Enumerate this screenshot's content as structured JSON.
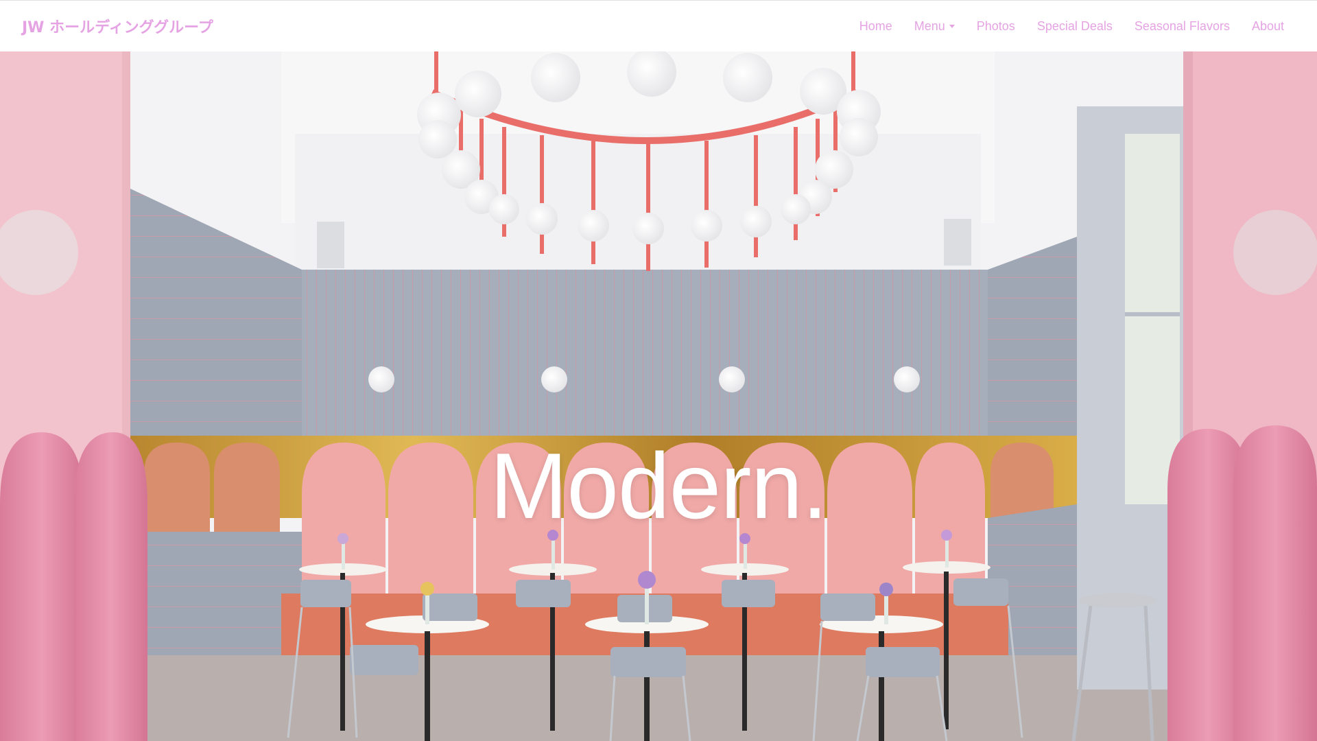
{
  "navbar": {
    "brand": "JW ホールディンググループ",
    "links": {
      "home": "Home",
      "menu": "Menu",
      "photos": "Photos",
      "special_deals": "Special Deals",
      "seasonal_flavors": "Seasonal Flavors",
      "about": "About"
    }
  },
  "hero": {
    "title": "Modern."
  },
  "colors": {
    "accent": "#e5a3e3",
    "pink_wall": "#f2c3cc",
    "tile_gray": "#a9b0bd",
    "brass": "#c99a3a",
    "coral": "#e96e6a"
  },
  "icons": {
    "menu_dropdown": "caret-down-icon"
  }
}
